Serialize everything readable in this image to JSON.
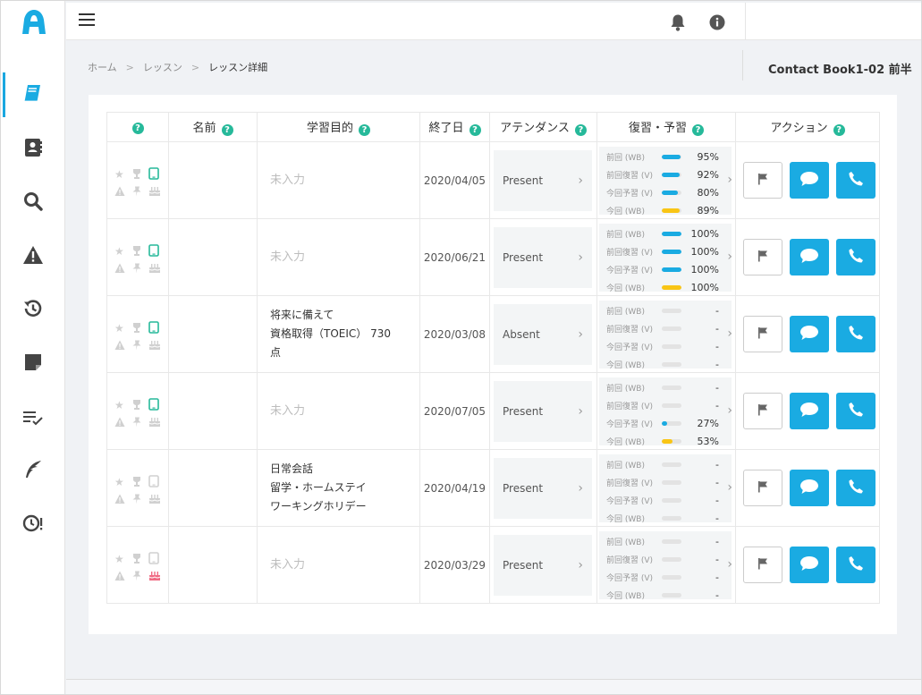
{
  "colors": {
    "accent": "#1aabe2",
    "help": "#26b99a",
    "yellow": "#f9c515",
    "cake_active": "#f06b84",
    "device_active": "#26b99a"
  },
  "sidebar": {
    "logo_letter": "A",
    "items": [
      {
        "name": "sidebar-item-lessons",
        "icon": "book-icon",
        "active": true
      },
      {
        "name": "sidebar-item-contacts",
        "icon": "contact-book-icon",
        "active": false
      },
      {
        "name": "sidebar-item-search",
        "icon": "search-icon",
        "active": false
      },
      {
        "name": "sidebar-item-alerts",
        "icon": "warning-icon",
        "active": false
      },
      {
        "name": "sidebar-item-history",
        "icon": "history-icon",
        "active": false
      },
      {
        "name": "sidebar-item-notes",
        "icon": "sticky-note-icon",
        "active": false
      },
      {
        "name": "sidebar-item-checklist",
        "icon": "checklist-icon",
        "active": false
      },
      {
        "name": "sidebar-item-feedback",
        "icon": "feather-icon",
        "active": false
      },
      {
        "name": "sidebar-item-overdue",
        "icon": "clock-alert-icon",
        "active": false
      }
    ]
  },
  "topbar": {
    "menu_icon": "hamburger-icon",
    "bell_icon": "bell-icon",
    "info_icon": "info-icon"
  },
  "breadcrumb": {
    "home": "ホーム",
    "lessons": "レッスン",
    "current": "レッスン詳細"
  },
  "page_title": "Contact Book1-02 前半",
  "table": {
    "headers": {
      "status": "",
      "name": "名前",
      "goal": "学習目的",
      "end_date": "終了日",
      "attendance": "アテンダンス",
      "review": "復習・予習",
      "action": "アクション"
    },
    "review_labels": [
      "前回 (WB)",
      "前回復習 (V)",
      "今回予習 (V)",
      "今回 (WB)"
    ],
    "rows": [
      {
        "device_active": true,
        "cake_active": false,
        "name": "",
        "goal_lines": [
          "未入力"
        ],
        "goal_empty": true,
        "end_date": "2020/04/05",
        "attendance": "Present",
        "review": [
          {
            "pct": "95%",
            "fill": 0.95,
            "color": "blue"
          },
          {
            "pct": "92%",
            "fill": 0.92,
            "color": "blue"
          },
          {
            "pct": "80%",
            "fill": 0.8,
            "color": "blue"
          },
          {
            "pct": "89%",
            "fill": 0.89,
            "color": "yellow"
          }
        ]
      },
      {
        "device_active": true,
        "cake_active": false,
        "name": "",
        "goal_lines": [
          "未入力"
        ],
        "goal_empty": true,
        "end_date": "2020/06/21",
        "attendance": "Present",
        "review": [
          {
            "pct": "100%",
            "fill": 1.0,
            "color": "blue"
          },
          {
            "pct": "100%",
            "fill": 1.0,
            "color": "blue"
          },
          {
            "pct": "100%",
            "fill": 1.0,
            "color": "blue"
          },
          {
            "pct": "100%",
            "fill": 1.0,
            "color": "yellow"
          }
        ]
      },
      {
        "device_active": true,
        "cake_active": false,
        "name": "",
        "goal_lines": [
          "将来に備えて",
          "資格取得（TOEIC） 730",
          "点"
        ],
        "goal_empty": false,
        "end_date": "2020/03/08",
        "attendance": "Absent",
        "review": [
          {
            "pct": "-",
            "fill": 0,
            "color": "blue"
          },
          {
            "pct": "-",
            "fill": 0,
            "color": "blue"
          },
          {
            "pct": "-",
            "fill": 0,
            "color": "blue"
          },
          {
            "pct": "-",
            "fill": 0,
            "color": "yellow"
          }
        ]
      },
      {
        "device_active": true,
        "cake_active": false,
        "name": "",
        "goal_lines": [
          "未入力"
        ],
        "goal_empty": true,
        "end_date": "2020/07/05",
        "attendance": "Present",
        "review": [
          {
            "pct": "-",
            "fill": 0,
            "color": "blue"
          },
          {
            "pct": "-",
            "fill": 0,
            "color": "blue"
          },
          {
            "pct": "27%",
            "fill": 0.27,
            "color": "blue"
          },
          {
            "pct": "53%",
            "fill": 0.53,
            "color": "yellow"
          }
        ]
      },
      {
        "device_active": false,
        "cake_active": false,
        "name": "",
        "goal_lines": [
          "日常会話",
          "留学・ホームステイ",
          "ワーキングホリデー"
        ],
        "goal_empty": false,
        "end_date": "2020/04/19",
        "attendance": "Present",
        "review": [
          {
            "pct": "-",
            "fill": 0,
            "color": "blue"
          },
          {
            "pct": "-",
            "fill": 0,
            "color": "blue"
          },
          {
            "pct": "-",
            "fill": 0,
            "color": "blue"
          },
          {
            "pct": "-",
            "fill": 0,
            "color": "yellow"
          }
        ]
      },
      {
        "device_active": false,
        "cake_active": true,
        "name": "",
        "goal_lines": [
          "未入力"
        ],
        "goal_empty": true,
        "end_date": "2020/03/29",
        "attendance": "Present",
        "review": [
          {
            "pct": "-",
            "fill": 0,
            "color": "blue"
          },
          {
            "pct": "-",
            "fill": 0,
            "color": "blue"
          },
          {
            "pct": "-",
            "fill": 0,
            "color": "blue"
          },
          {
            "pct": "-",
            "fill": 0,
            "color": "yellow"
          }
        ]
      }
    ]
  }
}
